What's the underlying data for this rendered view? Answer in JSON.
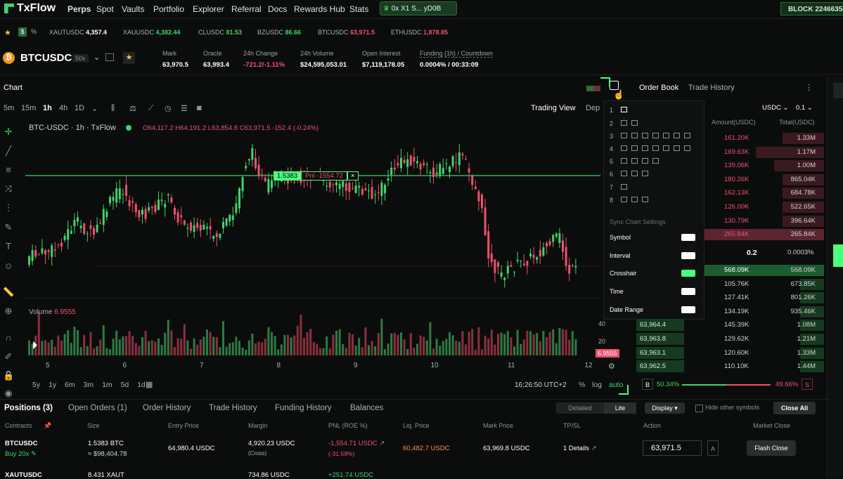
{
  "nav": {
    "brand": "TxFlow",
    "items": [
      "Perps",
      "Spot",
      "Vaults",
      "Portfolio",
      "Explorer",
      "Referral",
      "Docs",
      "Rewards Hub",
      "Stats"
    ],
    "wallet": "0x X1 S... yD0B",
    "block": "BLOCK 22466354"
  },
  "ticker": [
    {
      "sym": "XAUTUSDC",
      "price": "4,357.4",
      "dir": "neutral"
    },
    {
      "sym": "XAUUSDC",
      "price": "4,382.44",
      "dir": "green"
    },
    {
      "sym": "CLUSDC",
      "price": "81.53",
      "dir": "green"
    },
    {
      "sym": "BZUSDC",
      "price": "86.66",
      "dir": "green"
    },
    {
      "sym": "BTCUSDC",
      "price": "63,971.5",
      "dir": "red"
    },
    {
      "sym": "ETHUSDC",
      "price": "1,878.85",
      "dir": "red"
    }
  ],
  "market": {
    "symbol": "BTCUSDC",
    "leverage": "50x",
    "mark_label": "Mark",
    "mark": "63,970.5",
    "oracle_label": "Oracle",
    "oracle": "63,993.4",
    "change_label": "24h Change",
    "change": "-721.2/-1.11%",
    "volume_label": "24h Volume",
    "volume": "$24,595,053.01",
    "oi_label": "Open Interest",
    "oi": "$7,119,178.05",
    "funding_label": "Funding (1h) / Countdown",
    "funding": "0.0004% / 00:33:09"
  },
  "chart": {
    "panel_title": "Chart",
    "intervals": [
      "5m",
      "15m",
      "1h",
      "4h",
      "1D"
    ],
    "active_interval": "1h",
    "trading_view": "Trading View",
    "depth": "Dep",
    "legend_symbol": "BTC-USDC · 1h · TxFlow",
    "ohlc": "O64,117.2 H64,191.2 L63,854.8 C63,971.5 -152.4 (-0.24%)",
    "volume_label": "Volume",
    "volume_value": "6.9555",
    "position_size": "1.5383",
    "position_pnl": "Pnl -1554.72",
    "price_tag": "6.9555",
    "x_ticks": [
      "5",
      "6",
      "7",
      "8",
      "9",
      "10",
      "11",
      "12"
    ],
    "vol_ticks": [
      "40",
      "20"
    ],
    "ranges": [
      "5y",
      "1y",
      "6m",
      "3m",
      "1m",
      "5d",
      "1d"
    ],
    "time": "16:26:50 UTC+2",
    "pct": "%",
    "log": "log",
    "auto": "auto"
  },
  "layout_popover": {
    "rows": [
      "1",
      "2",
      "3",
      "4",
      "5",
      "6",
      "7",
      "8"
    ],
    "sync_title": "Sync Chart Settings",
    "sync": [
      {
        "label": "Symbol",
        "on": false
      },
      {
        "label": "Interval",
        "on": false
      },
      {
        "label": "Crosshair",
        "on": true
      },
      {
        "label": "Time",
        "on": false
      },
      {
        "label": "Date Range",
        "on": false
      }
    ]
  },
  "orderbook": {
    "tab_book": "Order Book",
    "tab_trades": "Trade History",
    "unit": "USDC",
    "step": "0.1",
    "col_amount": "Amount(USDC)",
    "col_total": "Total(USDC)",
    "asks": [
      {
        "amount": "161.20K",
        "total": "1.33M",
        "fill": 0.35
      },
      {
        "amount": "169.63K",
        "total": "1.17M",
        "fill": 0.57
      },
      {
        "amount": "139.06K",
        "total": "1.00M",
        "fill": 0.42
      },
      {
        "amount": "180.26K",
        "total": "865.04K",
        "fill": 0.35
      },
      {
        "amount": "162.13K",
        "total": "684.78K",
        "fill": 0.35
      },
      {
        "amount": "126.00K",
        "total": "522.65K",
        "fill": 0.35
      },
      {
        "amount": "130.79K",
        "total": "396.64K",
        "fill": 0.35
      },
      {
        "amount": "265.84K",
        "total": "265.84K",
        "fill": 1.0
      }
    ],
    "spread": "0.2",
    "spread_pct": "0.0003%",
    "bids": [
      {
        "price": "",
        "amount": "568.09K",
        "total": "568.09K",
        "fill": 1.0
      },
      {
        "price": "",
        "amount": "105.76K",
        "total": "673.85K",
        "fill": 0.2
      },
      {
        "price": "",
        "amount": "127.41K",
        "total": "801.26K",
        "fill": 0.2
      },
      {
        "price": "",
        "amount": "134.19K",
        "total": "935.46K",
        "fill": 0.2
      },
      {
        "price": "63,964.4",
        "amount": "145.39K",
        "total": "1.08M",
        "fill": 0.2
      },
      {
        "price": "63,963.8",
        "amount": "129.62K",
        "total": "1.21M",
        "fill": 0.2
      },
      {
        "price": "63,963.1",
        "amount": "120.60K",
        "total": "1.33M",
        "fill": 0.2
      },
      {
        "price": "63,962.5",
        "amount": "110.10K",
        "total": "1.44M",
        "fill": 0.2
      }
    ],
    "buy_label": "B",
    "buy_pct": "50.34%",
    "sell_pct": "49.66%",
    "sell_label": "S"
  },
  "positions": {
    "tabs": [
      "Positions (3)",
      "Open Orders (1)",
      "Order History",
      "Trade History",
      "Funding History",
      "Balances"
    ],
    "view_detailed": "Detailed",
    "view_lite": "Lite",
    "display": "Display ▾",
    "hide_other": "Hide other symbols",
    "close_all": "Close All",
    "headers": [
      "Contracts",
      "Size",
      "Entry Price",
      "Margin",
      "PNL (ROE %)",
      "Liq. Price",
      "Mark Price",
      "TP/SL",
      "Action",
      "Market Close"
    ],
    "rows": [
      {
        "contract": "BTCUSDC",
        "side": "Buy 20x",
        "size": "1.5383 BTC",
        "size_usd": "≈ $98,404.78",
        "entry": "64,980.4 USDC",
        "margin": "4,920.23 USDC",
        "margin_mode": "(Cross)",
        "pnl": "-1,554.71 USDC",
        "roe": "(-31.59%)",
        "liq": "60,482.7 USDC",
        "mark": "63,969.8 USDC",
        "tpsl": "1 Details",
        "action_value": "63,971.5",
        "close": "Flash Close"
      },
      {
        "contract": "XAUTUSDC",
        "side": "",
        "size": "8.431 XAUT",
        "size_usd": "",
        "entry": "",
        "margin": "734.86 USDC",
        "margin_mode": "",
        "pnl": "+251.74 USDC",
        "roe": "",
        "liq": "",
        "mark": "",
        "tpsl": "",
        "action_value": "",
        "close": ""
      }
    ]
  },
  "colors": {
    "up": "#3fd46b",
    "down": "#f0506e",
    "bg": "#0b0d0c",
    "accent": "#4cff7a"
  }
}
